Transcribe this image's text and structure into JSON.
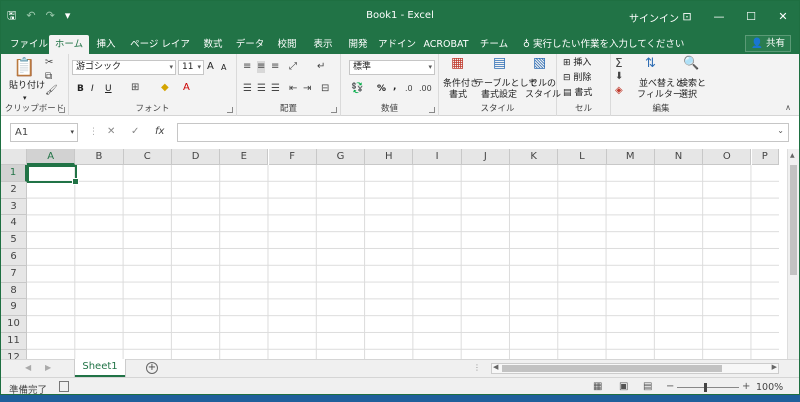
{
  "window": {
    "title": "Book1 - Excel",
    "signin": "サインイン",
    "icons": {
      "minimize": "—",
      "maximize": "☐",
      "close": "✕",
      "ribbon_display": "⊡"
    }
  },
  "qat": {
    "save_icon": "🖫",
    "undo_icon": "↶",
    "redo_icon": "↷",
    "customize_icon": "▾"
  },
  "tabs": [
    {
      "label": "ファイル",
      "active": false
    },
    {
      "label": "ホーム",
      "active": true
    },
    {
      "label": "挿入",
      "active": false
    },
    {
      "label": "ページ レイアウト",
      "active": false
    },
    {
      "label": "数式",
      "active": false
    },
    {
      "label": "データ",
      "active": false
    },
    {
      "label": "校閲",
      "active": false
    },
    {
      "label": "表示",
      "active": false
    },
    {
      "label": "開発",
      "active": false
    },
    {
      "label": "アドイン",
      "active": false
    },
    {
      "label": "ACROBAT",
      "active": false
    },
    {
      "label": "チーム",
      "active": false
    }
  ],
  "tellme": "実行したい作業を入力してください",
  "share": "共有",
  "ribbon": {
    "clipboard": {
      "label": "クリップボード",
      "paste": "貼り付け"
    },
    "font": {
      "label": "フォント",
      "name": "游ゴシック",
      "size": "11",
      "bold": "B",
      "italic": "I",
      "underline": "U",
      "grow": "A",
      "shrink": "A"
    },
    "alignment": {
      "label": "配置"
    },
    "number": {
      "label": "数値",
      "format": "標準",
      "percent": "%",
      "comma": ","
    },
    "styles": {
      "label": "スタイル",
      "conditional": [
        "条件付き",
        "書式"
      ],
      "table": [
        "テーブルとして",
        "書式設定"
      ],
      "cell": [
        "セルの",
        "スタイル"
      ]
    },
    "cells": {
      "label": "セル",
      "insert": "挿入",
      "delete": "削除",
      "format": "書式"
    },
    "editing": {
      "label": "編集",
      "sort": [
        "並べ替えと",
        "フィルター"
      ],
      "find": [
        "検索と",
        "選択"
      ]
    }
  },
  "formula_bar": {
    "name_box": "A1",
    "cancel": "✕",
    "enter": "✓",
    "fx": "fx",
    "value": ""
  },
  "columns": [
    "A",
    "B",
    "C",
    "D",
    "E",
    "F",
    "G",
    "H",
    "I",
    "J",
    "K",
    "L",
    "M",
    "N",
    "O",
    "P"
  ],
  "rows": [
    "1",
    "2",
    "3",
    "4",
    "5",
    "6",
    "7",
    "8",
    "9",
    "10",
    "11",
    "12"
  ],
  "sheets": [
    {
      "name": "Sheet1",
      "active": true
    }
  ],
  "status": {
    "ready": "準備完了",
    "zoom": "100%",
    "zoom_minus": "−",
    "zoom_plus": "+"
  }
}
